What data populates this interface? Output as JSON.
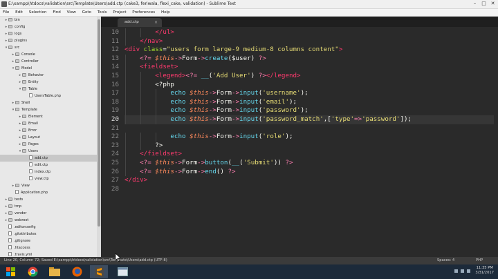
{
  "window": {
    "title": "E:\\xampp\\htdocs\\validation\\src\\Template\\Users\\add.ctp (cake3, feriwala, flexi_cake, validation) - Sublime Text",
    "controls": [
      "–",
      "□",
      "✕"
    ]
  },
  "menu": [
    "File",
    "Edit",
    "Selection",
    "Find",
    "View",
    "Goto",
    "Tools",
    "Project",
    "Preferences",
    "Help"
  ],
  "sidebar": {
    "items": [
      {
        "label": "bin",
        "type": "folder",
        "depth": 1,
        "arrow": "▸"
      },
      {
        "label": "config",
        "type": "folder",
        "depth": 1,
        "arrow": "▸"
      },
      {
        "label": "logs",
        "type": "folder",
        "depth": 1,
        "arrow": "▸"
      },
      {
        "label": "plugins",
        "type": "folder",
        "depth": 1,
        "arrow": "▸"
      },
      {
        "label": "src",
        "type": "folder",
        "depth": 1,
        "arrow": "▾"
      },
      {
        "label": "Console",
        "type": "folder",
        "depth": 2,
        "arrow": "▸"
      },
      {
        "label": "Controller",
        "type": "folder",
        "depth": 2,
        "arrow": "▸"
      },
      {
        "label": "Model",
        "type": "folder",
        "depth": 2,
        "arrow": "▾"
      },
      {
        "label": "Behavior",
        "type": "folder",
        "depth": 3,
        "arrow": "▸"
      },
      {
        "label": "Entity",
        "type": "folder",
        "depth": 3,
        "arrow": "▸"
      },
      {
        "label": "Table",
        "type": "folder",
        "depth": 3,
        "arrow": "▾"
      },
      {
        "label": "UsersTable.php",
        "type": "file",
        "depth": 4,
        "arrow": ""
      },
      {
        "label": "Shell",
        "type": "folder",
        "depth": 2,
        "arrow": "▸"
      },
      {
        "label": "Template",
        "type": "folder",
        "depth": 2,
        "arrow": "▾"
      },
      {
        "label": "Element",
        "type": "folder",
        "depth": 3,
        "arrow": "▸"
      },
      {
        "label": "Email",
        "type": "folder",
        "depth": 3,
        "arrow": "▸"
      },
      {
        "label": "Error",
        "type": "folder",
        "depth": 3,
        "arrow": "▸"
      },
      {
        "label": "Layout",
        "type": "folder",
        "depth": 3,
        "arrow": "▸"
      },
      {
        "label": "Pages",
        "type": "folder",
        "depth": 3,
        "arrow": "▸"
      },
      {
        "label": "Users",
        "type": "folder",
        "depth": 3,
        "arrow": "▾"
      },
      {
        "label": "add.ctp",
        "type": "file",
        "depth": 4,
        "arrow": "",
        "selected": true
      },
      {
        "label": "edit.ctp",
        "type": "file",
        "depth": 4,
        "arrow": ""
      },
      {
        "label": "index.ctp",
        "type": "file",
        "depth": 4,
        "arrow": ""
      },
      {
        "label": "view.ctp",
        "type": "file",
        "depth": 4,
        "arrow": ""
      },
      {
        "label": "View",
        "type": "folder",
        "depth": 2,
        "arrow": "▸"
      },
      {
        "label": "Application.php",
        "type": "file",
        "depth": 2,
        "arrow": ""
      },
      {
        "label": "tests",
        "type": "folder",
        "depth": 1,
        "arrow": "▸"
      },
      {
        "label": "tmp",
        "type": "folder",
        "depth": 1,
        "arrow": "▸"
      },
      {
        "label": "vendor",
        "type": "folder",
        "depth": 1,
        "arrow": "▸"
      },
      {
        "label": "webroot",
        "type": "folder",
        "depth": 1,
        "arrow": "▸"
      },
      {
        "label": ".editorconfig",
        "type": "file",
        "depth": 1,
        "arrow": ""
      },
      {
        "label": ".gitattributes",
        "type": "file",
        "depth": 1,
        "arrow": ""
      },
      {
        "label": ".gitignore",
        "type": "file",
        "depth": 1,
        "arrow": ""
      },
      {
        "label": ".htaccess",
        "type": "file",
        "depth": 1,
        "arrow": ""
      },
      {
        "label": ".travis.yml",
        "type": "file",
        "depth": 1,
        "arrow": ""
      }
    ]
  },
  "tab": {
    "label": "add.ctp",
    "close": "×"
  },
  "editor": {
    "current_line": 20,
    "lines": [
      {
        "n": 10,
        "indent": 2,
        "tokens": [
          [
            "t",
            "</ul>"
          ]
        ]
      },
      {
        "n": 11,
        "indent": 1,
        "tokens": [
          [
            "t",
            "</nav>"
          ]
        ]
      },
      {
        "n": 12,
        "indent": 0,
        "tokens": [
          [
            "t",
            "<div "
          ],
          [
            "a",
            "class"
          ],
          [
            "w",
            "="
          ],
          [
            "s",
            "\"users form large-9 medium-8 columns content\""
          ],
          [
            "t",
            ">"
          ]
        ]
      },
      {
        "n": 13,
        "indent": 1,
        "tokens": [
          [
            "p",
            "<?= "
          ],
          [
            "v",
            "$this"
          ],
          [
            "p",
            "->"
          ],
          [
            "w",
            "Form"
          ],
          [
            "p",
            "->"
          ],
          [
            "k",
            "create"
          ],
          [
            "w",
            "($user) "
          ],
          [
            "p",
            "?>"
          ]
        ]
      },
      {
        "n": 14,
        "indent": 1,
        "tokens": [
          [
            "t",
            "<fieldset>"
          ]
        ]
      },
      {
        "n": 15,
        "indent": 2,
        "tokens": [
          [
            "t",
            "<legend>"
          ],
          [
            "p",
            "<?= "
          ],
          [
            "k",
            "__"
          ],
          [
            "w",
            "("
          ],
          [
            "s",
            "'Add User'"
          ],
          [
            "w",
            ") "
          ],
          [
            "p",
            "?>"
          ],
          [
            "t",
            "</legend>"
          ]
        ]
      },
      {
        "n": 16,
        "indent": 2,
        "tokens": [
          [
            "w",
            "<?php"
          ]
        ]
      },
      {
        "n": 17,
        "indent": 3,
        "tokens": [
          [
            "k",
            "echo "
          ],
          [
            "v",
            "$this"
          ],
          [
            "p",
            "->"
          ],
          [
            "w",
            "Form"
          ],
          [
            "p",
            "->"
          ],
          [
            "k",
            "input"
          ],
          [
            "w",
            "("
          ],
          [
            "s",
            "'username'"
          ],
          [
            "w",
            ");"
          ]
        ]
      },
      {
        "n": 18,
        "indent": 3,
        "tokens": [
          [
            "k",
            "echo "
          ],
          [
            "v",
            "$this"
          ],
          [
            "p",
            "->"
          ],
          [
            "w",
            "Form"
          ],
          [
            "p",
            "->"
          ],
          [
            "k",
            "input"
          ],
          [
            "w",
            "("
          ],
          [
            "s",
            "'email'"
          ],
          [
            "w",
            ");"
          ]
        ]
      },
      {
        "n": 19,
        "indent": 3,
        "tokens": [
          [
            "k",
            "echo "
          ],
          [
            "v",
            "$this"
          ],
          [
            "p",
            "->"
          ],
          [
            "w",
            "Form"
          ],
          [
            "p",
            "->"
          ],
          [
            "k",
            "input"
          ],
          [
            "w",
            "("
          ],
          [
            "s",
            "'password'"
          ],
          [
            "w",
            ");"
          ]
        ]
      },
      {
        "n": 20,
        "indent": 3,
        "tokens": [
          [
            "k",
            "echo "
          ],
          [
            "v",
            "$this"
          ],
          [
            "p",
            "->"
          ],
          [
            "w",
            "Form"
          ],
          [
            "p",
            "->"
          ],
          [
            "k",
            "input"
          ],
          [
            "w",
            "("
          ],
          [
            "s",
            "'password_match'"
          ],
          [
            "w",
            ",["
          ],
          [
            "s",
            "'type'"
          ],
          [
            "p",
            "=>"
          ],
          [
            "s",
            "'password'"
          ],
          [
            "w",
            "]);"
          ]
        ]
      },
      {
        "n": 21,
        "indent": 0,
        "tokens": []
      },
      {
        "n": 22,
        "indent": 3,
        "tokens": [
          [
            "k",
            "echo "
          ],
          [
            "v",
            "$this"
          ],
          [
            "p",
            "->"
          ],
          [
            "w",
            "Form"
          ],
          [
            "p",
            "->"
          ],
          [
            "k",
            "input"
          ],
          [
            "w",
            "("
          ],
          [
            "s",
            "'role'"
          ],
          [
            "w",
            ");"
          ]
        ]
      },
      {
        "n": 23,
        "indent": 2,
        "tokens": [
          [
            "w",
            "?>"
          ]
        ]
      },
      {
        "n": 24,
        "indent": 1,
        "tokens": [
          [
            "t",
            "</fieldset>"
          ]
        ]
      },
      {
        "n": 25,
        "indent": 1,
        "tokens": [
          [
            "p",
            "<?= "
          ],
          [
            "v",
            "$this"
          ],
          [
            "p",
            "->"
          ],
          [
            "w",
            "Form"
          ],
          [
            "p",
            "->"
          ],
          [
            "k",
            "button"
          ],
          [
            "w",
            "("
          ],
          [
            "k",
            "__"
          ],
          [
            "w",
            "("
          ],
          [
            "s",
            "'Submit'"
          ],
          [
            "w",
            ")) "
          ],
          [
            "p",
            "?>"
          ]
        ]
      },
      {
        "n": 26,
        "indent": 1,
        "tokens": [
          [
            "p",
            "<?= "
          ],
          [
            "v",
            "$this"
          ],
          [
            "p",
            "->"
          ],
          [
            "w",
            "Form"
          ],
          [
            "p",
            "->"
          ],
          [
            "k",
            "end"
          ],
          [
            "w",
            "() "
          ],
          [
            "p",
            "?>"
          ]
        ]
      },
      {
        "n": 27,
        "indent": 0,
        "tokens": [
          [
            "t",
            "</div>"
          ]
        ]
      },
      {
        "n": 28,
        "indent": 0,
        "tokens": []
      }
    ]
  },
  "status": {
    "left": "Line 20, Column 72; Saved E:\\xampp\\htdocs\\validation\\src\\Template\\Users\\add.ctp (UTF-8)",
    "spaces": "Spaces: 4",
    "syntax": "PHP"
  },
  "taskbar": {
    "icons": [
      "windows-start-icon",
      "chrome-icon",
      "file-explorer-icon",
      "firefox-icon",
      "sublime-text-icon",
      "app-window-icon"
    ],
    "time": "11:35 PM",
    "date": "3/31/2017"
  }
}
